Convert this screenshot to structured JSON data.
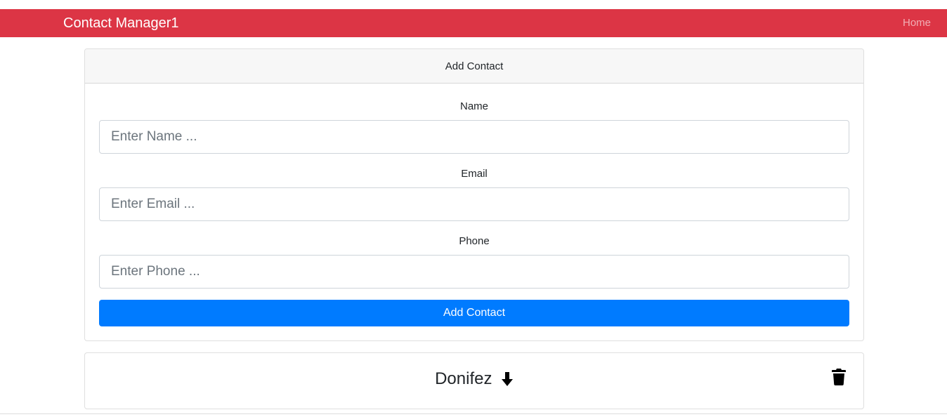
{
  "navbar": {
    "brand": "Contact Manager1",
    "home_link": "Home",
    "color": "#dc3545"
  },
  "add_contact_form": {
    "header": "Add Contact",
    "fields": [
      {
        "label": "Name",
        "placeholder": "Enter Name ...",
        "value": ""
      },
      {
        "label": "Email",
        "placeholder": "Enter Email ...",
        "value": ""
      },
      {
        "label": "Phone",
        "placeholder": "Enter Phone ...",
        "value": ""
      }
    ],
    "submit_label": "Add Contact",
    "submit_color": "#007bff"
  },
  "contacts": [
    {
      "name": "Donifez",
      "toggle_icon": "arrow-down-icon",
      "delete_icon": "trash-icon"
    }
  ]
}
